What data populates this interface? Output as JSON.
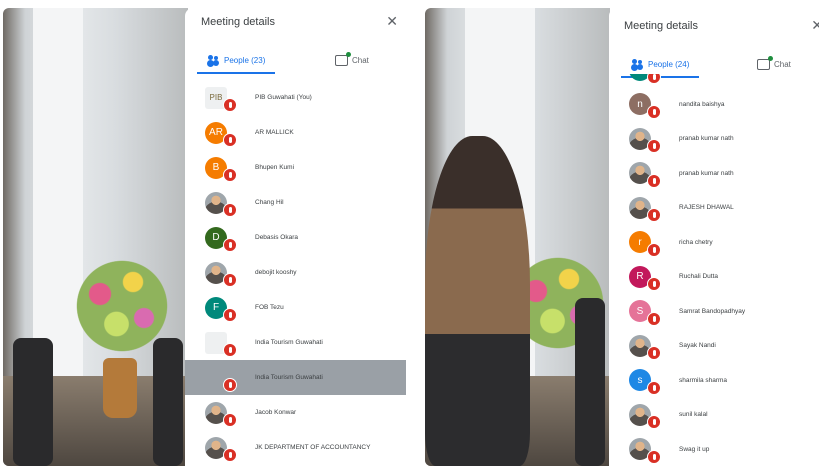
{
  "screenshots": [
    {
      "title": "Meeting details",
      "people_tab_label": "People (23)",
      "chat_tab_label": "Chat",
      "participants": [
        {
          "name": "PIB Guwahati (You)",
          "initials": "PIB",
          "avatar": "logo",
          "color": "#eef0f1"
        },
        {
          "name": "AR MALLICK",
          "initials": "AR",
          "avatar": "letter",
          "color": "#f57c00"
        },
        {
          "name": "Bhupen Kumi",
          "initials": "B",
          "avatar": "letter",
          "color": "#f57c00"
        },
        {
          "name": "Chang Hil",
          "initials": "",
          "avatar": "photo",
          "color": "#8d8d8d"
        },
        {
          "name": "Debasis Okara",
          "initials": "D",
          "avatar": "letter",
          "color": "#33691e"
        },
        {
          "name": "debojit kooshy",
          "initials": "",
          "avatar": "photo",
          "color": "#8d8d8d"
        },
        {
          "name": "FOB Tezu",
          "initials": "F",
          "avatar": "letter",
          "color": "#00897b"
        },
        {
          "name": "India Tourism Guwahati",
          "initials": "",
          "avatar": "logo",
          "color": "#eef0f1"
        },
        {
          "name": "India Tourism Guwahati",
          "initials": "",
          "avatar": "plain",
          "color": "#9aa0a6"
        },
        {
          "name": "Jacob Konwar",
          "initials": "",
          "avatar": "photo",
          "color": "#8d8d8d"
        },
        {
          "name": "JK DEPARTMENT OF ACCOUNTANCY",
          "initials": "",
          "avatar": "photo",
          "color": "#8d8d8d"
        }
      ]
    },
    {
      "title": "Meeting details",
      "people_tab_label": "People (24)",
      "chat_tab_label": "Chat",
      "participants": [
        {
          "name": "",
          "initials": "n",
          "avatar": "letter",
          "color": "#00897b"
        },
        {
          "name": "nandita baishya",
          "initials": "n",
          "avatar": "letter",
          "color": "#8d6e63"
        },
        {
          "name": "pranab kumar nath",
          "initials": "",
          "avatar": "photo",
          "color": "#8d8d8d"
        },
        {
          "name": "pranab kumar nath",
          "initials": "",
          "avatar": "photo",
          "color": "#8d8d8d"
        },
        {
          "name": "RAJESH DHAWAL",
          "initials": "",
          "avatar": "photo",
          "color": "#8d8d8d"
        },
        {
          "name": "richa chetry",
          "initials": "r",
          "avatar": "letter",
          "color": "#f57c00"
        },
        {
          "name": "Ruchali Dutta",
          "initials": "R",
          "avatar": "letter",
          "color": "#c2185b"
        },
        {
          "name": "Samrat Bandopadhyay",
          "initials": "S",
          "avatar": "letter",
          "color": "#e57398"
        },
        {
          "name": "Sayak Nandi",
          "initials": "",
          "avatar": "photo",
          "color": "#8d8d8d"
        },
        {
          "name": "sharmila sharma",
          "initials": "s",
          "avatar": "letter",
          "color": "#1e88e5"
        },
        {
          "name": "sunil kalal",
          "initials": "",
          "avatar": "photo",
          "color": "#8d8d8d"
        },
        {
          "name": "Swag it up",
          "initials": "",
          "avatar": "photo",
          "color": "#8d8d8d"
        }
      ]
    }
  ]
}
